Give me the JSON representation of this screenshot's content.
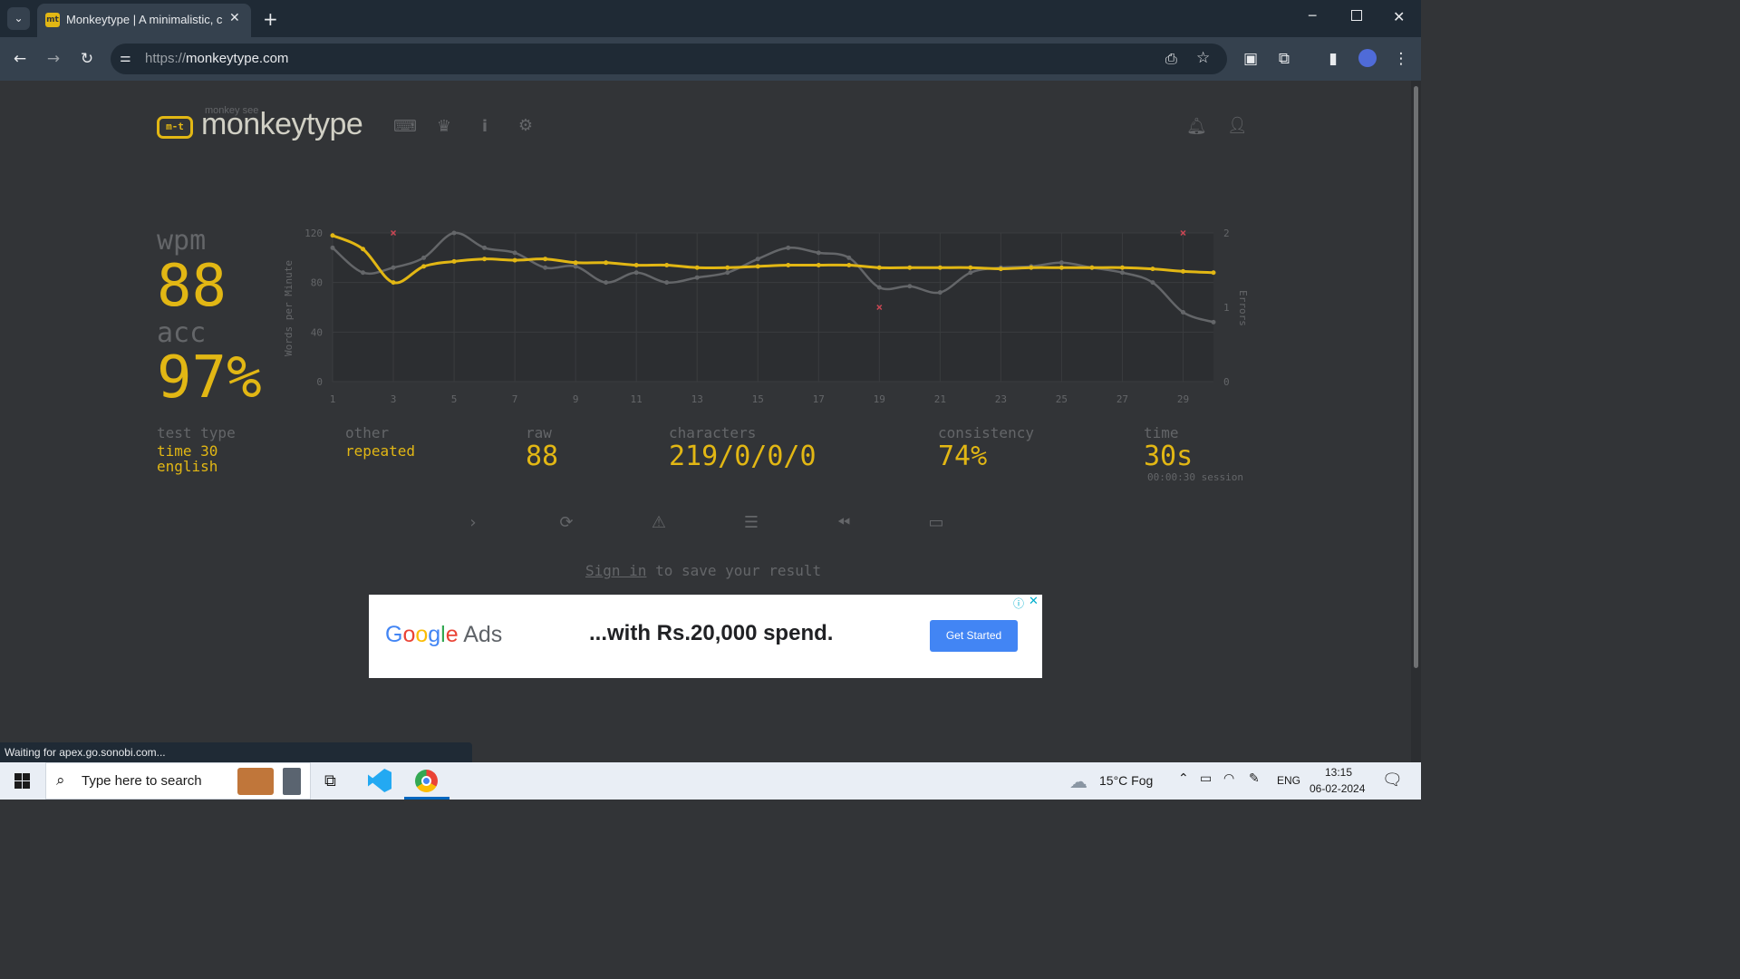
{
  "browser": {
    "tab_title": "Monkeytype | A minimalistic, customizable typing test",
    "tab_favicon": "mt",
    "url_scheme": "https://",
    "url_host": "monkeytype.com",
    "status_text": "Waiting for apex.go.sonobi.com..."
  },
  "header": {
    "logo_sub": "monkey see",
    "logo_text": "monkeytype",
    "logo_mark": "m-t"
  },
  "result": {
    "wpm_label": "wpm",
    "wpm_value": "88",
    "acc_label": "acc",
    "acc_value": "97%",
    "test_type_label": "test type",
    "test_type_line1": "time 30",
    "test_type_line2": "english",
    "other_label": "other",
    "other_value": "repeated",
    "raw_label": "raw",
    "raw_value": "88",
    "characters_label": "characters",
    "characters_value": "219/0/0/0",
    "consistency_label": "consistency",
    "consistency_value": "74%",
    "time_label": "time",
    "time_value": "30s",
    "session_text": "00:00:30 session"
  },
  "chart_data": {
    "type": "line",
    "xlabel": "",
    "ylabel": "Words per Minute",
    "y2label": "Errors",
    "x": [
      1,
      2,
      3,
      4,
      5,
      6,
      7,
      8,
      9,
      10,
      11,
      12,
      13,
      14,
      15,
      16,
      17,
      18,
      19,
      20,
      21,
      22,
      23,
      24,
      25,
      26,
      27,
      28,
      29,
      30
    ],
    "xticks": [
      "1",
      "3",
      "5",
      "7",
      "9",
      "11",
      "13",
      "15",
      "17",
      "19",
      "21",
      "23",
      "25",
      "27",
      "29"
    ],
    "yticks": [
      "0",
      "40",
      "80",
      "120"
    ],
    "y2ticks": [
      "0",
      "1",
      "2"
    ],
    "ylim": [
      0,
      120
    ],
    "y2lim": [
      0,
      2
    ],
    "series": [
      {
        "role": "wpm",
        "color": "#e2b714",
        "values": [
          118,
          107,
          80,
          93,
          97,
          99,
          98,
          99,
          96,
          96,
          94,
          94,
          92,
          92,
          93,
          94,
          94,
          94,
          92,
          92,
          92,
          92,
          91,
          92,
          92,
          92,
          92,
          91,
          89,
          88
        ]
      },
      {
        "role": "raw",
        "color": "#646669",
        "values": [
          108,
          88,
          92,
          100,
          120,
          108,
          104,
          92,
          93,
          80,
          88,
          80,
          84,
          88,
          99,
          108,
          104,
          100,
          76,
          77,
          72,
          88,
          92,
          93,
          96,
          92,
          88,
          80,
          56,
          48
        ]
      }
    ],
    "errors": [
      {
        "x": 3,
        "value": 2
      },
      {
        "x": 19,
        "value": 1
      },
      {
        "x": 29,
        "value": 2
      }
    ],
    "error_color": "#ca4754",
    "grid": true
  },
  "actions": {
    "signin_link": "Sign in",
    "signin_rest": " to save your result"
  },
  "ad": {
    "logo_google": "Google",
    "logo_ads": "Ads",
    "text": "...with Rs.20,000 spend.",
    "button": "Get Started"
  },
  "taskbar": {
    "search_placeholder": "Type here to search",
    "weather": "15°C  Fog",
    "lang": "ENG",
    "time": "13:15",
    "date": "06-02-2024"
  }
}
